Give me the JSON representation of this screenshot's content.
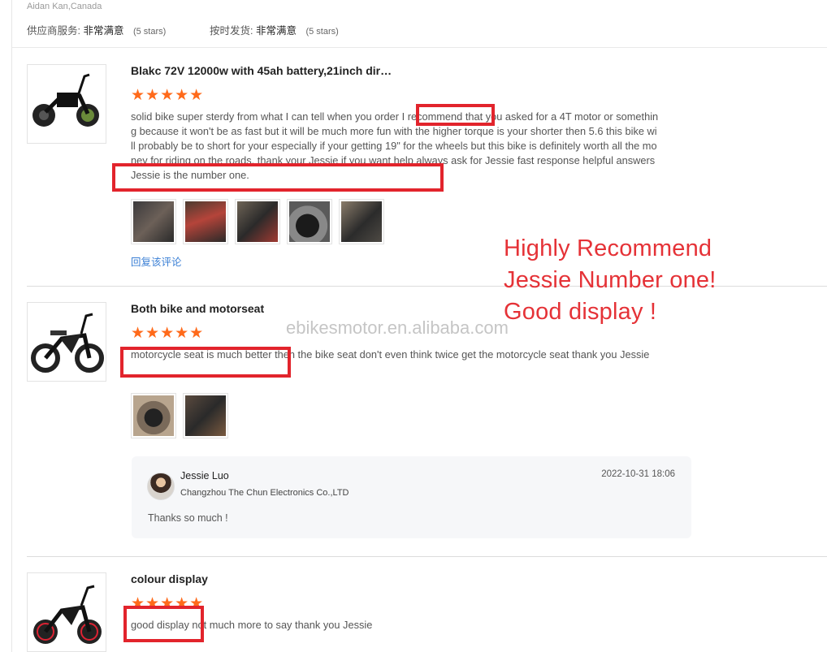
{
  "header": {
    "location": "Aidan Kan,Canada",
    "supplier_service_label": "供应商服务:",
    "supplier_service_value": "非常满意",
    "supplier_service_stars": "(5 stars)",
    "ontime_label": "按时发货:",
    "ontime_value": "非常满意",
    "ontime_stars": "(5 stars)"
  },
  "reviews": [
    {
      "title": "Blakc 72V 12000w with 45ah battery,21inch dir…",
      "stars": "★★★★★",
      "rating": 5,
      "body": "solid bike super sterdy from what I can tell when you order I recommend that you asked for a 4T motor or something because it won't be as fast but it will be much more fun with the higher torque is your shorter then 5.6 this bike will probably be to short for your especially if your getting 19\" for the wheels but this bike is definitely worth all the money for riding on the roads. thank your Jessie if you want help always ask for Jessie fast response helpful answers Jessie is the number one.",
      "reply_link": "回复该评论"
    },
    {
      "title": "Both bike and motorseat",
      "stars": "★★★★★",
      "rating": 5,
      "body": "motorcycle seat is much better then the bike seat don't even think twice get the motorcycle seat thank you Jessie"
    },
    {
      "title": "colour display",
      "stars": "★★★★★",
      "rating": 5,
      "body": "good display not much more to say thank you Jessie"
    }
  ],
  "seller_reply": {
    "name": "Jessie Luo",
    "company": "Changzhou The Chun Electronics Co.,LTD",
    "date": "2022-10-31 18:06",
    "message": "Thanks so much !"
  },
  "promo": {
    "line1": "Highly Recommend",
    "line2": "Jessie Number one!",
    "line3": "Good display !",
    "color": "#e53237"
  },
  "watermark": "ebikesmotor.en.alibaba.com",
  "colors": {
    "star": "#ff6a1a",
    "link": "#3a7fd5",
    "highlight_box": "#e2242c"
  }
}
